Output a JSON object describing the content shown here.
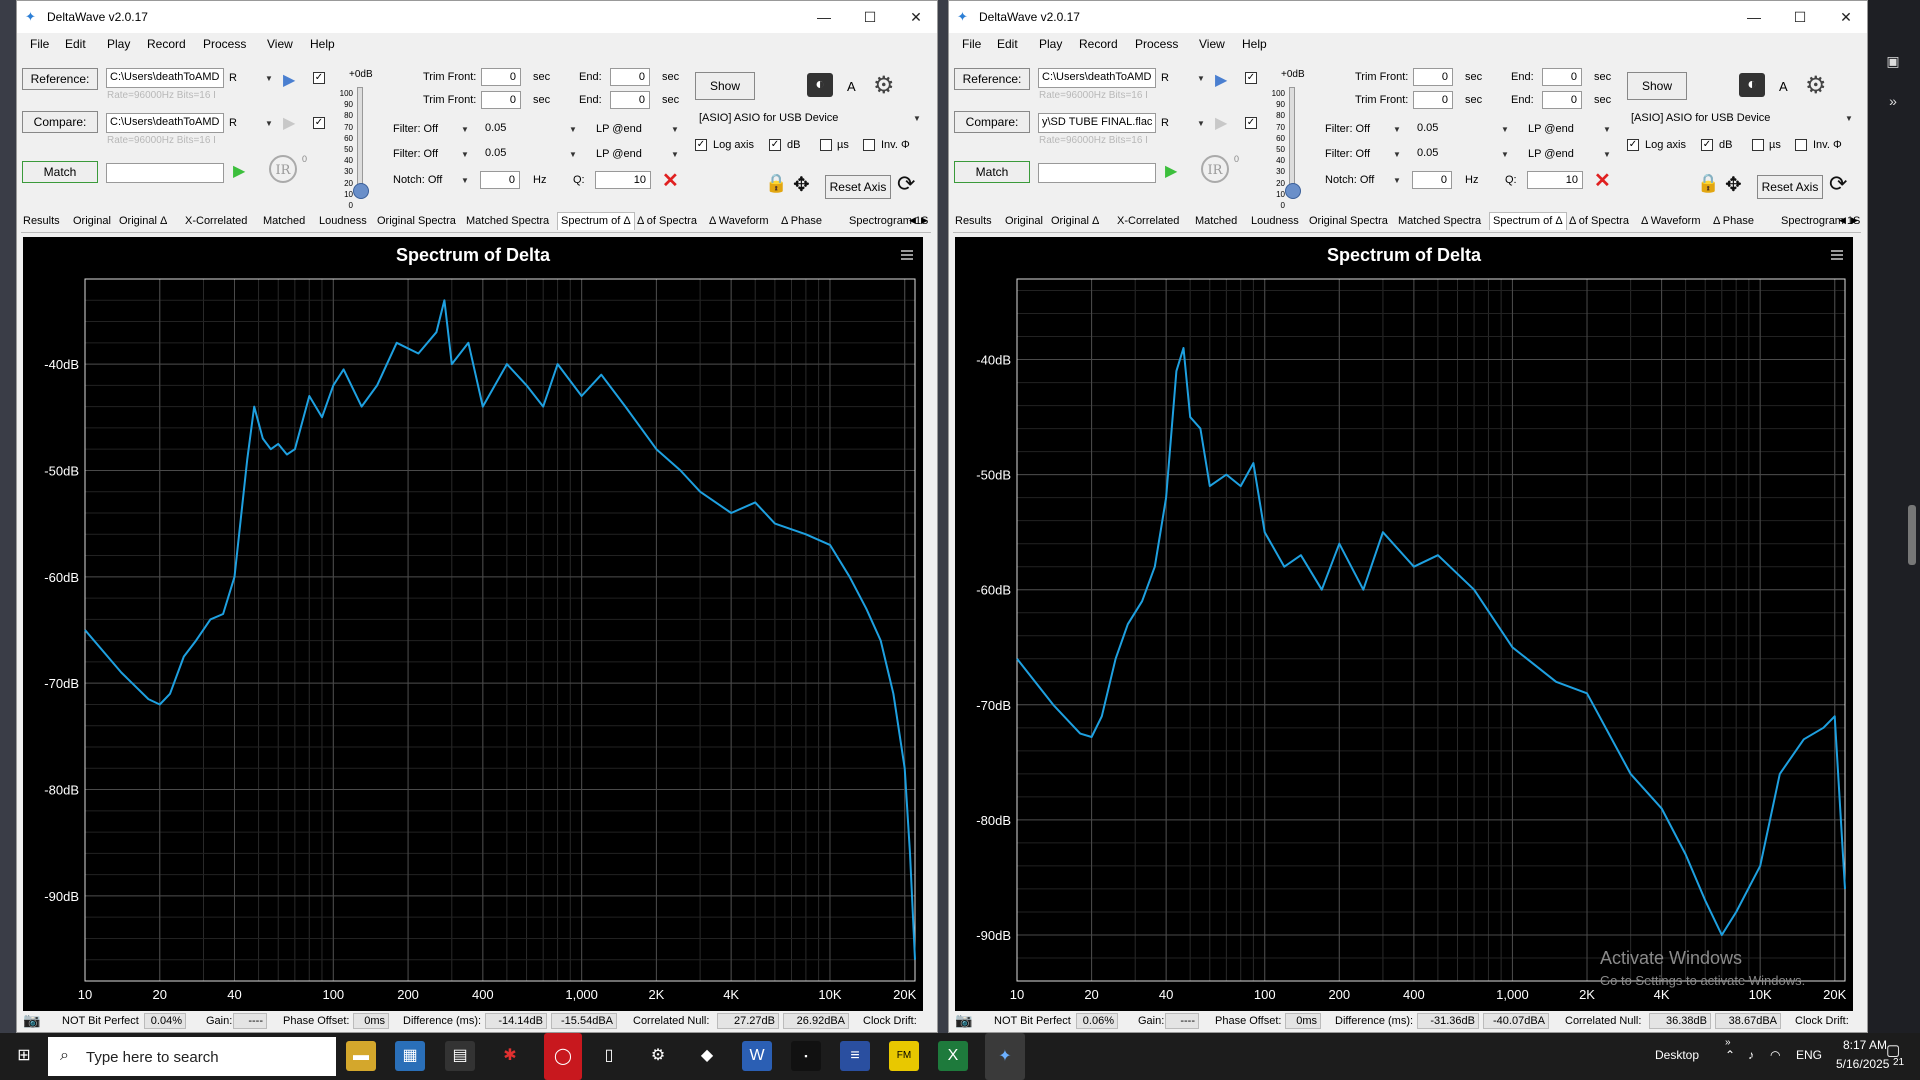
{
  "windows": [
    {
      "title": "DeltaWave v2.0.17",
      "menu": [
        "File",
        "Edit",
        "Play",
        "Record",
        "Process",
        "View",
        "Help"
      ],
      "reference_label": "Reference:",
      "reference_path": "C:\\Users\\deathToAMD",
      "reference_channel": "R",
      "reference_info": "Rate=96000Hz Bits=16 I",
      "compare_label": "Compare:",
      "compare_path": "C:\\Users\\deathToAMD",
      "compare_channel": "R",
      "compare_info": "Rate=96000Hz Bits=16 I",
      "match_label": "Match",
      "gain_top": "+0dB",
      "trim_front_label": "Trim Front:",
      "trim_front_1": "0",
      "trim_front_2": "0",
      "end_label": "End:",
      "end_1": "0",
      "end_2": "0",
      "sec_label": "sec",
      "show_label": "Show",
      "filter1": "Filter: Off",
      "filter1_val": "0.05",
      "filter1_lp": "LP @end",
      "filter2": "Filter: Off",
      "filter2_val": "0.05",
      "filter2_lp": "LP @end",
      "notch": "Notch: Off",
      "notch_val": "0",
      "hz_label": "Hz",
      "q_label": "Q:",
      "q_val": "10",
      "device": "[ASIO] ASIO for USB Device",
      "log_axis": "Log axis",
      "db_label": "dB",
      "us_label": "µs",
      "inv_label": "Inv. Φ",
      "reset_axis": "Reset Axis",
      "a_label": "A",
      "tabs": [
        "Results",
        "Original",
        "Original Δ",
        "X-Correlated",
        "Matched",
        "Loudness",
        "Original Spectra",
        "Matched Spectra",
        "Spectrum of Δ",
        "Δ of Spectra",
        "Δ Waveform",
        "Δ Phase",
        "Spectrogram 1",
        "S"
      ],
      "active_tab": "Spectrum of Δ",
      "status": {
        "bit_perfect": "NOT Bit Perfect",
        "bit_perfect_val": "0.04%",
        "gain_label": "Gain:",
        "gain_val": "----",
        "phase_label": "Phase Offset:",
        "phase_val": "0ms",
        "diff_label": "Difference (ms):",
        "diff_val1": "-14.14dB",
        "diff_val2": "-15.54dBA",
        "corr_label": "Correlated Null:",
        "corr_val1": "27.27dB",
        "corr_val2": "26.92dBA",
        "clock_label": "Clock Drift:"
      }
    },
    {
      "title": "DeltaWave v2.0.17",
      "menu": [
        "File",
        "Edit",
        "Play",
        "Record",
        "Process",
        "View",
        "Help"
      ],
      "reference_label": "Reference:",
      "reference_path": "C:\\Users\\deathToAMD",
      "reference_channel": "R",
      "reference_info": "Rate=96000Hz Bits=16 I",
      "compare_label": "Compare:",
      "compare_path": "y\\SD TUBE FINAL.flac",
      "compare_channel": "R",
      "compare_info": "Rate=96000Hz Bits=16 I",
      "match_label": "Match",
      "gain_top": "+0dB",
      "trim_front_label": "Trim Front:",
      "trim_front_1": "0",
      "trim_front_2": "0",
      "end_label": "End:",
      "end_1": "0",
      "end_2": "0",
      "sec_label": "sec",
      "show_label": "Show",
      "filter1": "Filter: Off",
      "filter1_val": "0.05",
      "filter1_lp": "LP @end",
      "filter2": "Filter: Off",
      "filter2_val": "0.05",
      "filter2_lp": "LP @end",
      "notch": "Notch: Off",
      "notch_val": "0",
      "hz_label": "Hz",
      "q_label": "Q:",
      "q_val": "10",
      "device": "[ASIO] ASIO for USB Device",
      "log_axis": "Log axis",
      "db_label": "dB",
      "us_label": "µs",
      "inv_label": "Inv. Φ",
      "reset_axis": "Reset Axis",
      "a_label": "A",
      "tabs": [
        "Results",
        "Original",
        "Original Δ",
        "X-Correlated",
        "Matched",
        "Loudness",
        "Original Spectra",
        "Matched Spectra",
        "Spectrum of Δ",
        "Δ of Spectra",
        "Δ Waveform",
        "Δ Phase",
        "Spectrogram 1",
        "S"
      ],
      "active_tab": "Spectrum of Δ",
      "status": {
        "bit_perfect": "NOT Bit Perfect",
        "bit_perfect_val": "0.06%",
        "gain_label": "Gain:",
        "gain_val": "----",
        "phase_label": "Phase Offset:",
        "phase_val": "0ms",
        "diff_label": "Difference (ms):",
        "diff_val1": "-31.36dB",
        "diff_val2": "-40.07dBA",
        "corr_label": "Correlated Null:",
        "corr_val1": "36.38dB",
        "corr_val2": "38.67dBA",
        "clock_label": "Clock Drift:"
      }
    }
  ],
  "slider_scale": [
    "100",
    "90",
    "80",
    "70",
    "60",
    "50",
    "40",
    "30",
    "20",
    "10",
    "0"
  ],
  "chart_data": [
    {
      "type": "line",
      "title": "Spectrum of Delta",
      "x_scale": "log",
      "xlim": [
        10,
        22000
      ],
      "ylim": [
        -98,
        -32
      ],
      "x_ticks": [
        10,
        20,
        40,
        100,
        200,
        400,
        1000,
        2000,
        4000,
        10000,
        20000
      ],
      "x_tick_labels": [
        "10",
        "20",
        "40",
        "100",
        "200",
        "400",
        "1,000",
        "2K",
        "4K",
        "10K",
        "20K"
      ],
      "y_ticks": [
        -40,
        -50,
        -60,
        -70,
        -80,
        -90
      ],
      "y_tick_labels": [
        "-40dB",
        "-50dB",
        "-60dB",
        "-70dB",
        "-80dB",
        "-90dB"
      ],
      "grid": true,
      "line_color": "#1ea0e0",
      "x": [
        10,
        14,
        18,
        20,
        22,
        25,
        28,
        32,
        36,
        40,
        45,
        48,
        52,
        56,
        60,
        65,
        70,
        80,
        90,
        100,
        110,
        130,
        150,
        180,
        220,
        260,
        280,
        300,
        350,
        400,
        500,
        600,
        700,
        800,
        1000,
        1200,
        1500,
        2000,
        2500,
        3000,
        4000,
        5000,
        6000,
        8000,
        10000,
        12000,
        14000,
        16000,
        18000,
        20000,
        21000,
        22000
      ],
      "y": [
        -65,
        -69,
        -71.5,
        -72,
        -71,
        -67.5,
        -66,
        -64,
        -63.5,
        -60,
        -49,
        -44,
        -47,
        -48,
        -47.5,
        -48.5,
        -48,
        -43,
        -45,
        -42,
        -40.5,
        -44,
        -42,
        -38,
        -39,
        -37,
        -34,
        -40,
        -38,
        -44,
        -40,
        -42,
        -44,
        -40,
        -43,
        -41,
        -44,
        -48,
        -50,
        -52,
        -54,
        -53,
        -55,
        -56,
        -57,
        -60,
        -63,
        -66,
        -71,
        -78,
        -86,
        -96
      ]
    },
    {
      "type": "line",
      "title": "Spectrum of Delta",
      "x_scale": "log",
      "xlim": [
        10,
        22000
      ],
      "ylim": [
        -94,
        -33
      ],
      "x_ticks": [
        10,
        20,
        40,
        100,
        200,
        400,
        1000,
        2000,
        4000,
        10000,
        20000
      ],
      "x_tick_labels": [
        "10",
        "20",
        "40",
        "100",
        "200",
        "400",
        "1,000",
        "2K",
        "4K",
        "10K",
        "20K"
      ],
      "y_ticks": [
        -40,
        -50,
        -60,
        -70,
        -80,
        -90
      ],
      "y_tick_labels": [
        "-40dB",
        "-50dB",
        "-60dB",
        "-70dB",
        "-80dB",
        "-90dB"
      ],
      "grid": true,
      "line_color": "#1ea0e0",
      "x": [
        10,
        14,
        18,
        20,
        22,
        25,
        28,
        32,
        36,
        40,
        44,
        47,
        50,
        55,
        60,
        70,
        80,
        90,
        100,
        120,
        140,
        170,
        200,
        250,
        300,
        400,
        500,
        700,
        1000,
        1500,
        2000,
        3000,
        4000,
        5000,
        6000,
        7000,
        8000,
        10000,
        12000,
        15000,
        18000,
        20000,
        22000
      ],
      "y": [
        -66,
        -70,
        -72.5,
        -72.8,
        -71,
        -66,
        -63,
        -61,
        -58,
        -52,
        -41,
        -39,
        -45,
        -46,
        -51,
        -50,
        -51,
        -49,
        -55,
        -58,
        -57,
        -60,
        -56,
        -60,
        -55,
        -58,
        -57,
        -60,
        -65,
        -68,
        -69,
        -76,
        -79,
        -83,
        -87,
        -90,
        -88,
        -84,
        -76,
        -73,
        -72,
        -71,
        -86
      ]
    }
  ],
  "watermark": {
    "line1": "Activate Windows",
    "line2": "Go to Settings to activate Windows."
  },
  "taskbar": {
    "search_placeholder": "Type here to search",
    "desktop_label": "Desktop",
    "lang": "ENG",
    "time": "8:17 AM",
    "date": "5/16/2025",
    "notif_count": "21"
  }
}
